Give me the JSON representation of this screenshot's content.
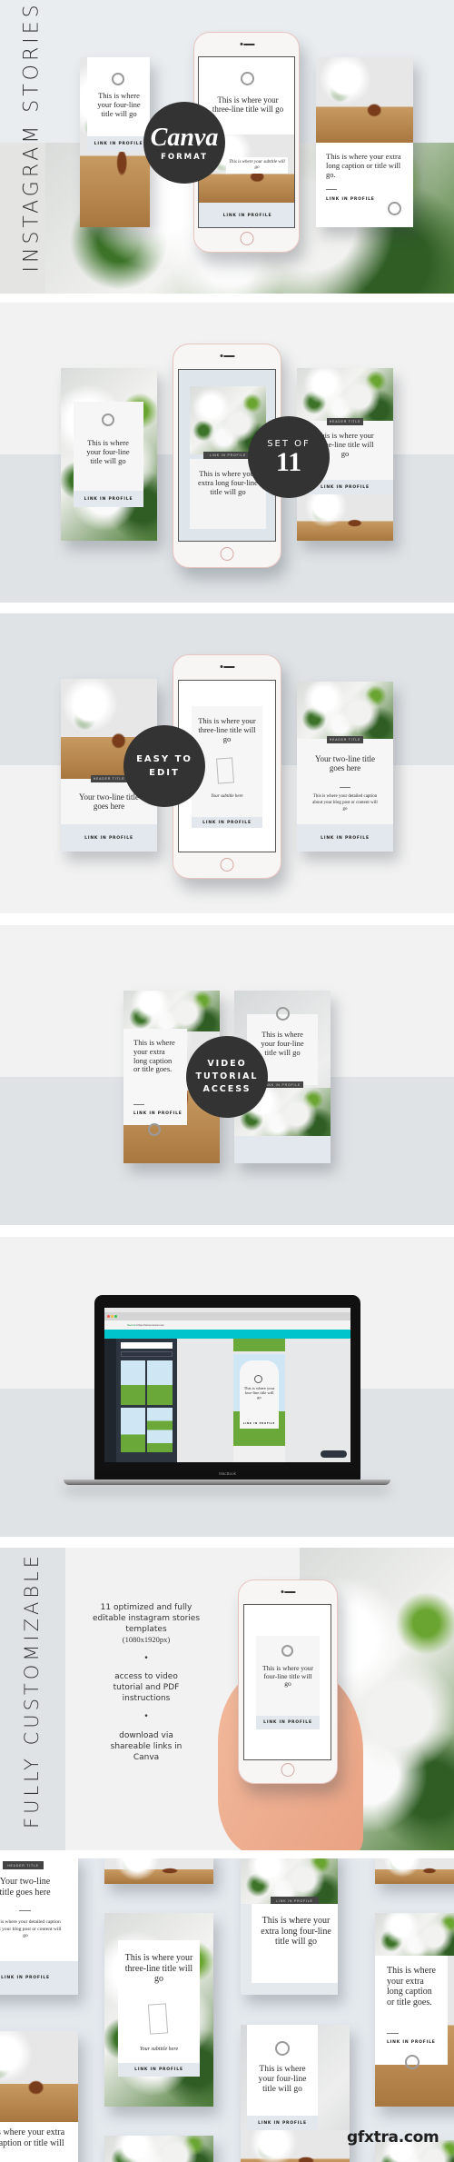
{
  "colors": {
    "badge": "#333333",
    "light_bg": "#f2f2f2",
    "blue_grey_bg": "#dfe3e6",
    "link_bar": "#e2e8ed",
    "canva_teal": "#00c4cc"
  },
  "link_label": "LINK IN PROFILE",
  "header_label": "HEADER TITLE",
  "section1": {
    "vertical_title": "INSTAGRAM STORIES",
    "badge": {
      "script": "Canva",
      "label": "FORMAT"
    },
    "left_card": {
      "title": "This is where your four-line title will go"
    },
    "phone": {
      "title": "This is where your three-line title will go",
      "subtitle": "This is where your subtitle will go"
    },
    "right_card": {
      "title": "This is where your extra long caption or title will go."
    }
  },
  "section2": {
    "badge": {
      "line1": "SET OF",
      "line2": "11"
    },
    "left_card": {
      "title": "This is where your four-line title will go"
    },
    "phone": {
      "title": "This is where your extra long four-line title will go"
    },
    "right_card": {
      "title": "This is where your three-line title will go"
    }
  },
  "section3": {
    "badge": {
      "line1": "EASY TO",
      "line2": "EDIT"
    },
    "left_card": {
      "title": "Your two-line title goes here"
    },
    "phone": {
      "title": "This is where your three-line title will go",
      "subtitle": "Your subtitle here"
    },
    "right_card": {
      "title": "Your two-line title goes here",
      "caption": "This is where your detailed caption about your blog post or content will go"
    }
  },
  "section4": {
    "badge": {
      "line1": "VIDEO",
      "line2": "TUTORIAL",
      "line3": "ACCESS"
    },
    "left_card": {
      "title": "This is where your extra long caption or title goes."
    },
    "right_card": {
      "title": "This is where your four-line title will go"
    }
  },
  "section5": {
    "laptop_brand": "MacBook",
    "browser": {
      "url": "https://www.canva.com",
      "secure": "Secure"
    },
    "design": {
      "title": "This is where your four-line title will go"
    }
  },
  "section6": {
    "vertical_title": "FULLY CUSTOMIZABLE",
    "features": [
      {
        "text": "11 optimized and fully editable instagram stories templates",
        "note": "(1080x1920px)"
      },
      {
        "text": "access to video tutorial and PDF instructions"
      },
      {
        "text": "download via shareable links in Canva"
      }
    ],
    "bullet": "•",
    "phone": {
      "title": "This is where your four-line title will go"
    }
  },
  "section7": {
    "card_a": {
      "title": "Your two-line title goes here",
      "caption": "This is where your detailed caption about your blog post or content will go"
    },
    "card_c": {
      "title": "This is where your three-line title will go",
      "subtitle": "Your subtitle here"
    },
    "card_d": {
      "title": "This is where your extra long four-line title will go"
    },
    "card_f": {
      "title": "This is where your extra long caption or title goes."
    },
    "card_g": {
      "title": "This is where your extra long caption or title will go."
    },
    "card_h": {
      "title": "This is where your four-line title will go"
    }
  },
  "watermark": "gfxtra.com"
}
